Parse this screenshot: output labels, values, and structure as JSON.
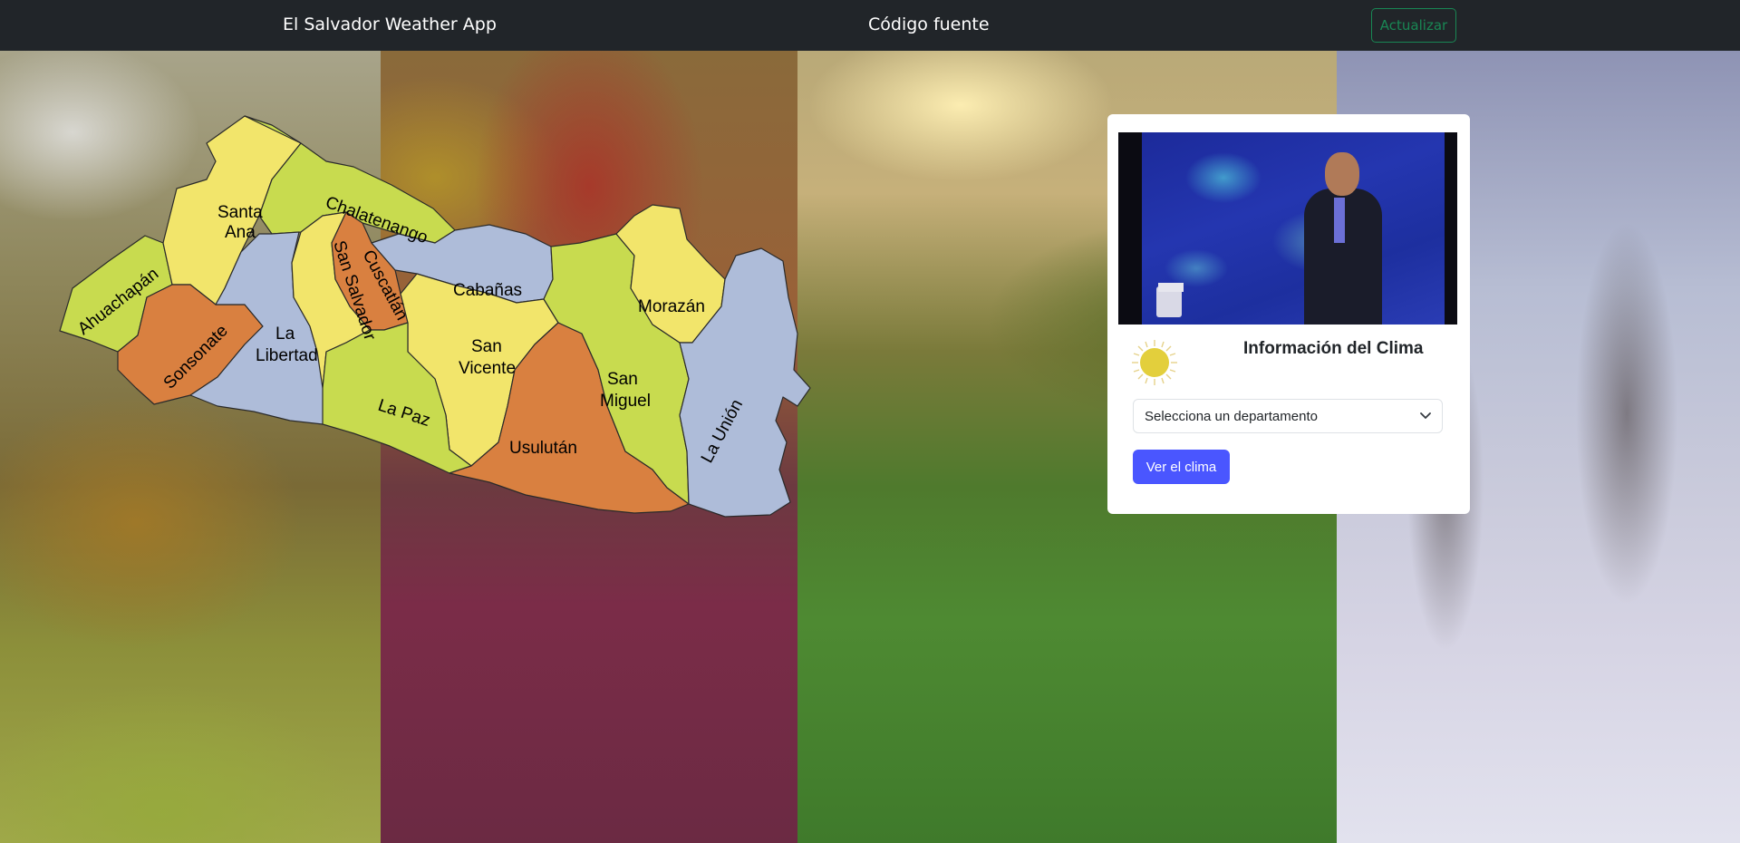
{
  "navbar": {
    "brand": "El Salvador Weather App",
    "link": "Código fuente",
    "refresh_label": "Actualizar"
  },
  "map": {
    "departments": [
      {
        "id": "ahuachapan",
        "label": "Ahuachapán",
        "color": "#c8db4f"
      },
      {
        "id": "santa-ana",
        "label_lines": [
          "Santa",
          "Ana"
        ],
        "color": "#f2e56b"
      },
      {
        "id": "chalatenango",
        "label": "Chalatenango",
        "color": "#c8db4f"
      },
      {
        "id": "sonsonate",
        "label": "Sonsonate",
        "color": "#d98040"
      },
      {
        "id": "la-libertad",
        "label_lines": [
          "La",
          "Libertad"
        ],
        "color": "#aebcd9"
      },
      {
        "id": "san-salvador",
        "label": "San Salvador",
        "color": "#f2e56b"
      },
      {
        "id": "cuscatlan",
        "label": "Cuscatlán",
        "color": "#d98040"
      },
      {
        "id": "cabanas",
        "label": "Cabañas",
        "color": "#aebcd9"
      },
      {
        "id": "la-paz",
        "label": "La Paz",
        "color": "#c8db4f"
      },
      {
        "id": "san-vicente",
        "label_lines": [
          "San",
          "Vicente"
        ],
        "color": "#f2e56b"
      },
      {
        "id": "usulutan",
        "label": "Usulután",
        "color": "#d98040"
      },
      {
        "id": "san-miguel",
        "label_lines": [
          "San",
          "Miguel"
        ],
        "color": "#c8db4f"
      },
      {
        "id": "morazan",
        "label": "Morazán",
        "color": "#f2e56b"
      },
      {
        "id": "la-union",
        "label": "La Unión",
        "color": "#aebcd9"
      }
    ]
  },
  "card": {
    "title": "Información del Clima",
    "select_value": "Selecciona un departamento",
    "button_label": "Ver el clima",
    "sun_color": "#e3cf3c"
  },
  "colors": {
    "navbar_bg": "#212529",
    "refresh_accent": "#198754",
    "primary": "#4a56ff"
  }
}
